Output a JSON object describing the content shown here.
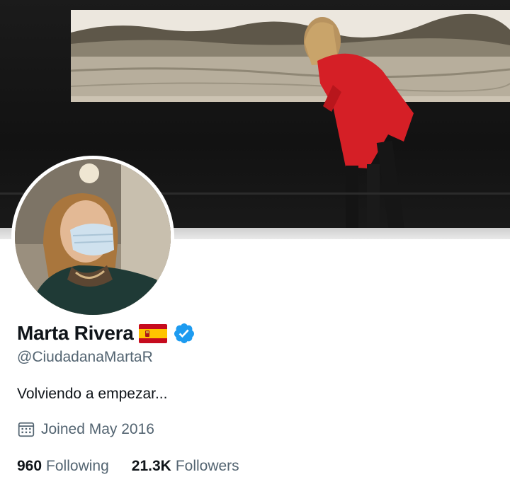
{
  "profile": {
    "display_name": "Marta Rivera",
    "flag_icon": "spain-flag-icon",
    "verified_icon": "verified-badge-icon",
    "handle": "@CiudadanaMartaR",
    "bio": "Volviendo a empezar...",
    "joined": "Joined May 2016",
    "joined_icon": "calendar-icon",
    "following_count": "960",
    "following_label": "Following",
    "followers_count": "21.3K",
    "followers_label": "Followers"
  },
  "colors": {
    "text_primary": "#0f1419",
    "text_secondary": "#536471",
    "verified_blue": "#1d9bf0",
    "flag_red": "#c60b1e",
    "flag_yellow": "#ffc400"
  }
}
